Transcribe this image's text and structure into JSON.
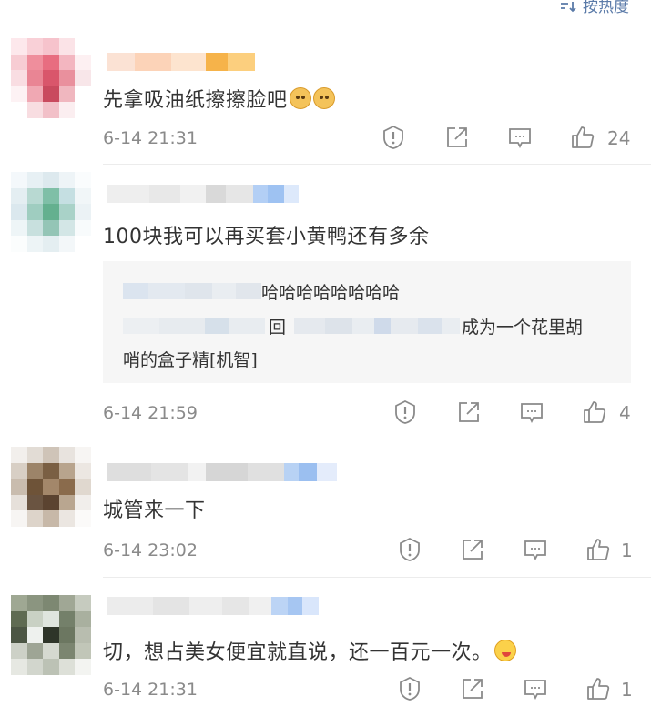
{
  "sort_label": "按热度",
  "comments": [
    {
      "text": "先拿吸油纸擦擦脸吧",
      "time": "6-14 21:31",
      "likes": "24",
      "emoji_count": 2
    },
    {
      "text": "100块我可以再买套小黄鸭还有多余",
      "time": "6-14 21:59",
      "likes": "4",
      "replies": [
        {
          "text": "哈哈哈哈哈哈哈哈"
        },
        {
          "mid": "回",
          "text": "成为一个花里胡",
          "text2": "哨的盒子精[机智]"
        }
      ]
    },
    {
      "text": "城管来一下",
      "time": "6-14 23:02",
      "likes": "1"
    },
    {
      "text": "切，想占美女便宜就直说，还一百元一次。",
      "time": "6-14 21:31",
      "likes": "1"
    }
  ],
  "colors": {
    "text": "#333333",
    "meta": "#8a8a8a",
    "accent": "#5a7aa8",
    "reply_bg": "#f6f6f6"
  },
  "icons": [
    "report-icon",
    "share-icon",
    "comment-icon",
    "like-icon",
    "sort-icon"
  ]
}
